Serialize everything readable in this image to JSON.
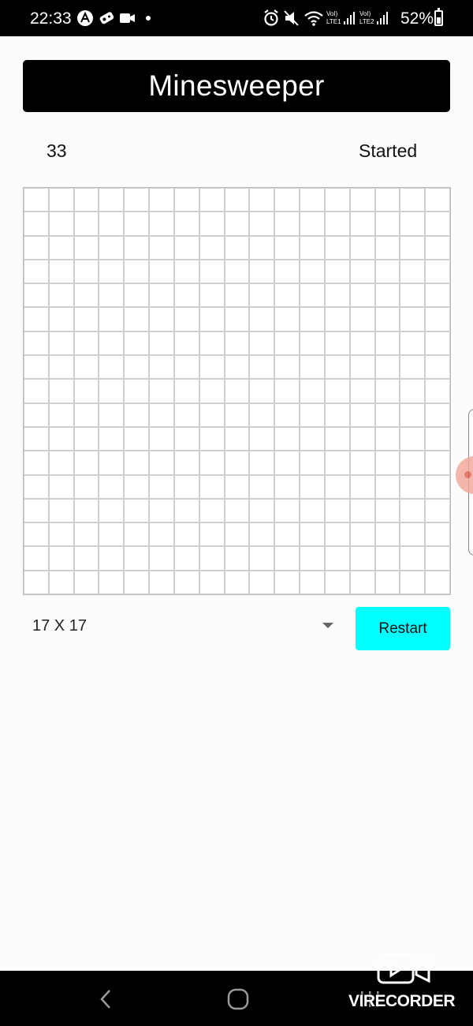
{
  "status_bar": {
    "time": "22:33",
    "battery": "52%",
    "left_icons": [
      "app-a-icon",
      "joystick-icon",
      "video-camera-icon",
      "dot-icon"
    ],
    "right_icons": [
      "alarm-icon",
      "mute-icon",
      "wifi-icon",
      "signal-lte1-icon",
      "signal-lte2-icon",
      "battery-icon"
    ]
  },
  "header": {
    "title": "Minesweeper"
  },
  "game": {
    "mine_count": "33",
    "status": "Started",
    "rows": 17,
    "cols": 17
  },
  "controls": {
    "size_selected": "17 X 17",
    "restart_label": "Restart"
  },
  "nav_bar": {
    "icons": [
      "back-icon",
      "home-icon",
      "recents-icon"
    ]
  },
  "watermark": {
    "text": "VIRECORDER"
  },
  "colors": {
    "restart_button": "#00ffff",
    "title_bar": "#000000",
    "cell_border": "#cfcfcf"
  }
}
